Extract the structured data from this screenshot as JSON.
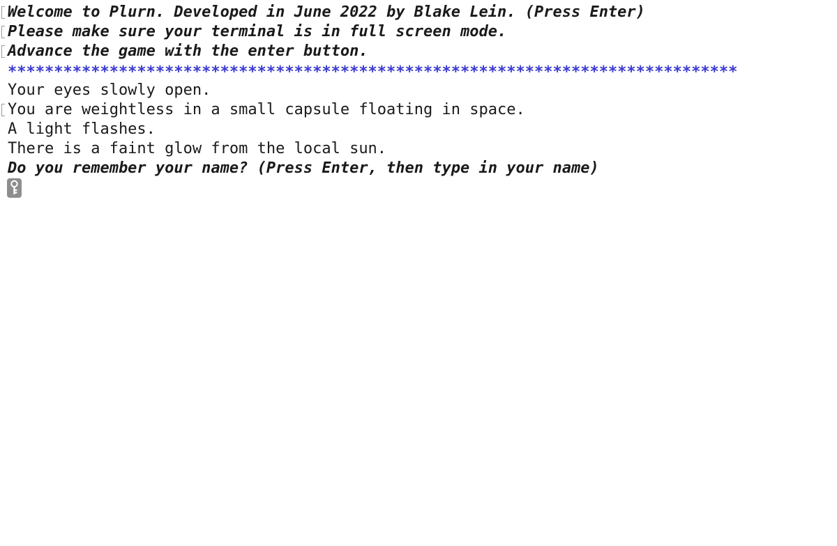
{
  "terminal": {
    "clipped_line": "                          ` ` ` ` ` ` ` ` ` ` ` `",
    "lines": [
      {
        "text": "Welcome to Plurn. Developed in June 2022 by Blake Lein. (Press Enter)",
        "style": "bold-italic",
        "marker": true
      },
      {
        "text": "Please make sure your terminal is in full screen mode.",
        "style": "bold-italic",
        "marker": true
      },
      {
        "text": "Advance the game with the enter button.",
        "style": "bold-italic",
        "marker": true
      },
      {
        "text": "*******************************************************************************",
        "style": "stars",
        "marker": false
      },
      {
        "text": "Your eyes slowly open.",
        "style": "plain",
        "marker": false
      },
      {
        "text": "You are weightless in a small capsule floating in space.",
        "style": "plain",
        "marker": true
      },
      {
        "text": "A light flashes.",
        "style": "plain",
        "marker": false
      },
      {
        "text": "There is a faint glow from the local sun.",
        "style": "plain",
        "marker": false
      },
      {
        "text": "Do you remember your name? (Press Enter, then type in your name)",
        "style": "bold-italic",
        "marker": false
      }
    ],
    "cursor_icon": "key-icon",
    "colors": {
      "text": "#1a1a1a",
      "stars": "#3a3ad0",
      "cursor": "#8e8e8e",
      "background": "#ffffff"
    }
  }
}
